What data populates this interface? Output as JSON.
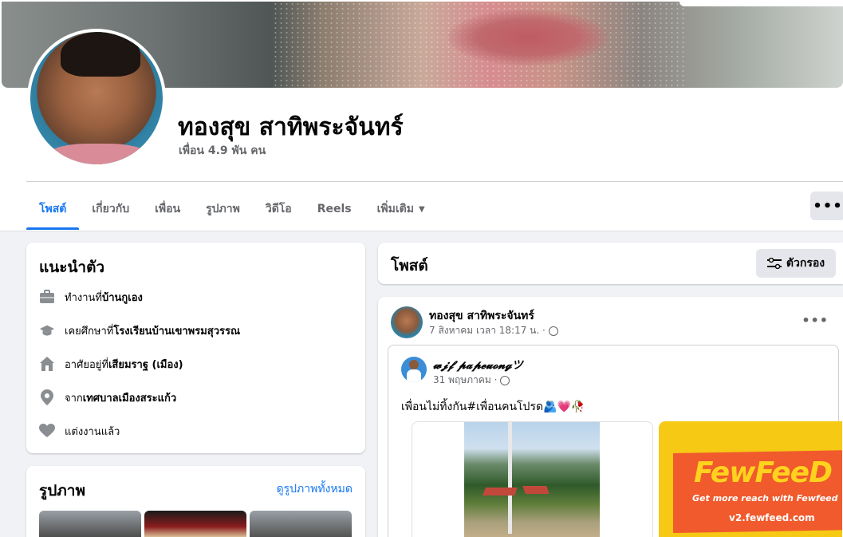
{
  "profile": {
    "name": "ทองสุข สาทิพระจันทร์",
    "friends": "เพื่อน 4.9 พัน คน"
  },
  "tabs": [
    {
      "label": "โพสต์",
      "active": true
    },
    {
      "label": "เกี่ยวกับ"
    },
    {
      "label": "เพื่อน"
    },
    {
      "label": "รูปภาพ"
    },
    {
      "label": "วิดีโอ"
    },
    {
      "label": "Reels"
    },
    {
      "label": "เพิ่มเติม"
    }
  ],
  "more_button": "•••",
  "intro": {
    "title": "แนะนำตัว",
    "rows": [
      {
        "icon": "briefcase-icon",
        "prefix": "ทำงานที่ ",
        "bold": "บ้านกูเอง"
      },
      {
        "icon": "graduation-cap-icon",
        "prefix": "เคยศึกษาที่ ",
        "bold": "โรงเรียนบ้านเขาพรมสุวรรณ"
      },
      {
        "icon": "home-icon",
        "prefix": "อาศัยอยู่ที่ ",
        "bold": "เสียมราฐ (เมือง)"
      },
      {
        "icon": "location-pin-icon",
        "prefix": "จาก ",
        "bold": "เทศบาลเมืองสระแก้ว"
      },
      {
        "icon": "heart-icon",
        "prefix": "แต่งงานแล้ว",
        "bold": ""
      }
    ]
  },
  "photos": {
    "title": "รูปภาพ",
    "see_all": "ดูรูปภาพทั้งหมด"
  },
  "posts": {
    "title": "โพสต์",
    "filter_label": "ตัวกรอง"
  },
  "post": {
    "author": "ทองสุข สาทิพระจันทร์",
    "time": "7 สิงหาคม เวลา 18:17 น. ·",
    "dots": "•••",
    "shared": {
      "author": "𝔀𝓳𝓯 𝓹𝓪𝓹𝓮𝓾𝓸𝓷𝓰ツ",
      "time": "31 พฤษภาคม ·",
      "text": "เพื่อนไม่ทิ้งกัน#เพื่อนคนโปรด🫂💗🥀"
    },
    "ad": {
      "brand": "FewFeeD",
      "tagline": "Get more reach with Fewfeed",
      "url": "v2.fewfeed.com"
    }
  },
  "colors": {
    "accent": "#1877f2",
    "secondary_text": "#65676b",
    "background": "#f0f2f5"
  }
}
